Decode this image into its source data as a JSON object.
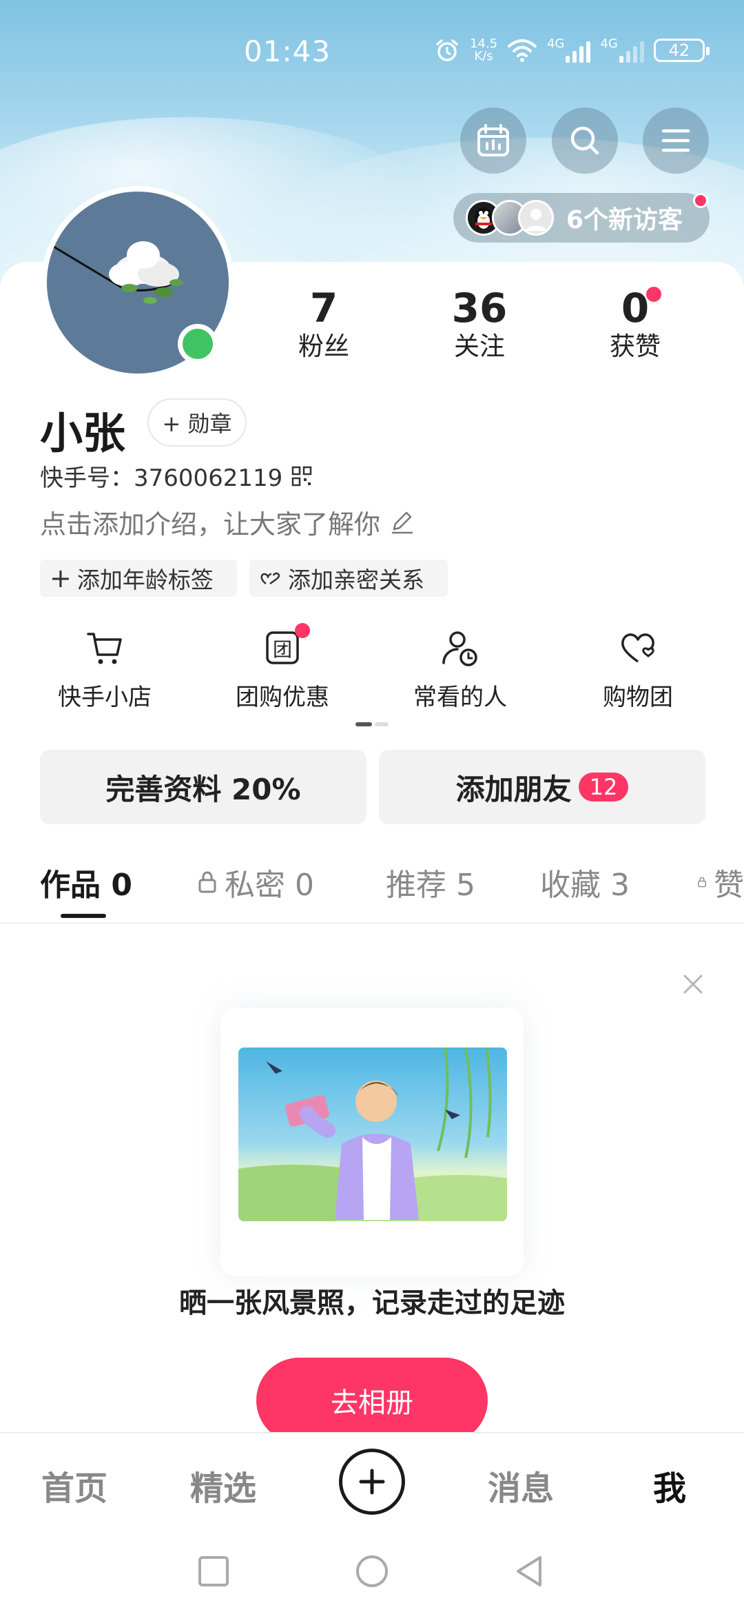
{
  "status_bar": {
    "time": "01:43",
    "net_speed_top": "14.5",
    "net_speed_bottom": "K/s",
    "signal1": "4G",
    "signal2": "4G",
    "battery": "42"
  },
  "header": {
    "visitors_label": "6个新访客"
  },
  "profile": {
    "name": "小张",
    "badge_button": "+ 勋章",
    "kuaishou_id": "快手号：3760062119",
    "intro_placeholder": "点击添加介绍，让大家了解你",
    "tag_age": "添加年龄标签",
    "tag_relation": "添加亲密关系"
  },
  "stats": [
    {
      "value": "7",
      "label": "粉丝"
    },
    {
      "value": "36",
      "label": "关注"
    },
    {
      "value": "0",
      "label": "获赞"
    }
  ],
  "services": [
    {
      "label": "快手小店",
      "icon": "cart-icon"
    },
    {
      "label": "团购优惠",
      "icon": "group-buy-icon"
    },
    {
      "label": "常看的人",
      "icon": "user-clock-icon"
    },
    {
      "label": "购物团",
      "icon": "heart-shop-icon"
    }
  ],
  "actions": {
    "complete_profile": "完善资料 20%",
    "add_friends": "添加朋友",
    "add_friends_count": "12"
  },
  "tabs": [
    {
      "label": "作品 0",
      "locked": false,
      "active": true
    },
    {
      "label": "私密 0",
      "locked": true,
      "active": false
    },
    {
      "label": "推荐 5",
      "locked": false,
      "active": false
    },
    {
      "label": "收藏 3",
      "locked": false,
      "active": false
    },
    {
      "label": "赞",
      "locked": true,
      "active": false
    }
  ],
  "empty_state": {
    "prompt": "晒一张风景照，记录走过的足迹",
    "button": "去相册"
  },
  "bottom_nav": {
    "home": "首页",
    "featured": "精选",
    "messages": "消息",
    "me": "我"
  },
  "colors": {
    "accent": "#fe3666",
    "online": "#40c463"
  }
}
